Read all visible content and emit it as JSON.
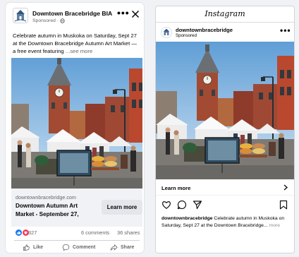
{
  "facebook": {
    "page_name": "Downtown Bracebridge BIA",
    "sponsored": "Sponsored",
    "more_options": "•••",
    "caption": "Celebrate autumn in Muskoka on Saturday, Sept 27 at the Downtown Bracebridge Autumn Art Market — a free event featuring",
    "see_more": "...see more",
    "link_domain": "downtownbracebridge.com",
    "link_title": "Downtown Autumn Art Market - September 27,",
    "cta": "Learn more",
    "reaction_count": "327",
    "comments": "6 comments",
    "shares": "36 shares",
    "actions": {
      "like": "Like",
      "comment": "Comment",
      "share": "Share"
    }
  },
  "instagram": {
    "brand": "Instagram",
    "username": "downtownbracebridge",
    "sponsored": "Sponsored",
    "more_options": "•••",
    "cta": "Learn more",
    "caption_user": "downtownbracebridge",
    "caption_text": " Celebrate autumn in Muskoka on Saturday, Sept 27 at the Downtown Bracebridge...",
    "caption_more": " more"
  },
  "colors": {
    "like_blue": "#1877f2",
    "love_red": "#f33e58",
    "meta_gray": "#65676b",
    "sky": "#7fb1dc"
  },
  "icons": [
    "bia-logo-icon",
    "globe-icon",
    "close-icon",
    "like-reaction-icon",
    "love-reaction-icon",
    "thumbs-up-icon",
    "comment-icon",
    "share-icon",
    "chevron-right-icon",
    "heart-icon",
    "paper-plane-icon",
    "bookmark-icon"
  ]
}
